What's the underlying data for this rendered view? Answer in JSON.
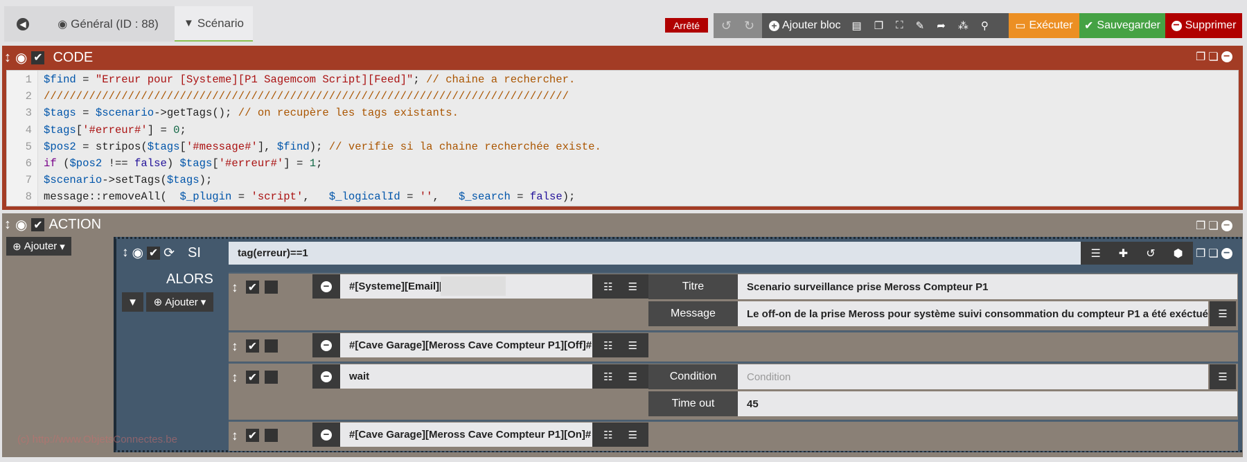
{
  "tabs": {
    "back_icon": "arrow-circle-left-icon",
    "general": "Général (ID : 88)",
    "scenario": "Scénario"
  },
  "toolbar": {
    "status": "Arrêté",
    "add_block": "Ajouter bloc",
    "execute": "Exécuter",
    "save": "Sauvegarder",
    "delete": "Supprimer"
  },
  "colors": {
    "code_block": "#a33c25",
    "action_block": "#8a8076",
    "si_block": "#44596d",
    "execute": "#ec8f23",
    "save": "#45a244",
    "delete": "#b00000",
    "status": "#b00000"
  },
  "code_block": {
    "title": "CODE",
    "lines": [
      [
        [
          "var",
          "$find"
        ],
        [
          "plain",
          " = "
        ],
        [
          "str",
          "\"Erreur pour [Systeme][P1 Sagemcom Script][Feed]\""
        ],
        [
          "plain",
          "; "
        ],
        [
          "com",
          "// chaine a rechercher."
        ]
      ],
      [
        [
          "com",
          "/////////////////////////////////////////////////////////////////////////////////"
        ]
      ],
      [
        [
          "var",
          "$tags"
        ],
        [
          "plain",
          " = "
        ],
        [
          "var",
          "$scenario"
        ],
        [
          "plain",
          "->getTags(); "
        ],
        [
          "com",
          "// on recupère les tags existants."
        ]
      ],
      [
        [
          "var",
          "$tags"
        ],
        [
          "plain",
          "["
        ],
        [
          "str",
          "'#erreur#'"
        ],
        [
          "plain",
          "] = "
        ],
        [
          "num",
          "0"
        ],
        [
          "plain",
          ";"
        ]
      ],
      [
        [
          "var",
          "$pos2"
        ],
        [
          "plain",
          " = stripos("
        ],
        [
          "var",
          "$tags"
        ],
        [
          "plain",
          "["
        ],
        [
          "str",
          "'#message#'"
        ],
        [
          "plain",
          "], "
        ],
        [
          "var",
          "$find"
        ],
        [
          "plain",
          "); "
        ],
        [
          "com",
          "// verifie si la chaine recherchée existe."
        ]
      ],
      [
        [
          "kw",
          "if"
        ],
        [
          "plain",
          " ("
        ],
        [
          "var",
          "$pos2"
        ],
        [
          "plain",
          " !== "
        ],
        [
          "atom",
          "false"
        ],
        [
          "plain",
          ") "
        ],
        [
          "var",
          "$tags"
        ],
        [
          "plain",
          "["
        ],
        [
          "str",
          "'#erreur#'"
        ],
        [
          "plain",
          "] = "
        ],
        [
          "num",
          "1"
        ],
        [
          "plain",
          ";"
        ]
      ],
      [
        [
          "var",
          "$scenario"
        ],
        [
          "plain",
          "->setTags("
        ],
        [
          "var",
          "$tags"
        ],
        [
          "plain",
          ");"
        ]
      ],
      [
        [
          "plain",
          "message::removeAll(  "
        ],
        [
          "var",
          "$_plugin"
        ],
        [
          "plain",
          " = "
        ],
        [
          "str",
          "'script'"
        ],
        [
          "plain",
          ",   "
        ],
        [
          "var",
          "$_logicalId"
        ],
        [
          "plain",
          " = "
        ],
        [
          "str",
          "''"
        ],
        [
          "plain",
          ",   "
        ],
        [
          "var",
          "$_search"
        ],
        [
          "plain",
          " = "
        ],
        [
          "atom",
          "false"
        ],
        [
          "plain",
          ");"
        ]
      ]
    ]
  },
  "action_block": {
    "title": "ACTION",
    "add": "Ajouter"
  },
  "si": {
    "label": "SI",
    "condition": "tag(erreur)==1",
    "then_label": "ALORS",
    "add": "Ajouter",
    "actions": [
      {
        "cmd": "#[Systeme][Email][",
        "enabled": true,
        "fields": [
          {
            "label": "Titre",
            "value": "Scenario surveillance prise Meross Compteur P1"
          },
          {
            "label": "Message",
            "value": "Le off-on de la prise Meross pour système suivi consommation du compteur P1 a été exéctué"
          }
        ]
      },
      {
        "cmd": "#[Cave Garage][Meross Cave Compteur P1][Off]#",
        "enabled": true
      },
      {
        "cmd": "wait",
        "enabled": true,
        "fields": [
          {
            "label": "Condition",
            "value": "",
            "placeholder": "Condition"
          },
          {
            "label": "Time out",
            "value": "45"
          }
        ]
      },
      {
        "cmd": "#[Cave Garage][Meross Cave Compteur P1][On]#",
        "enabled": true
      }
    ]
  },
  "watermark": "(c) http://www.ObjetsConnectes.be"
}
